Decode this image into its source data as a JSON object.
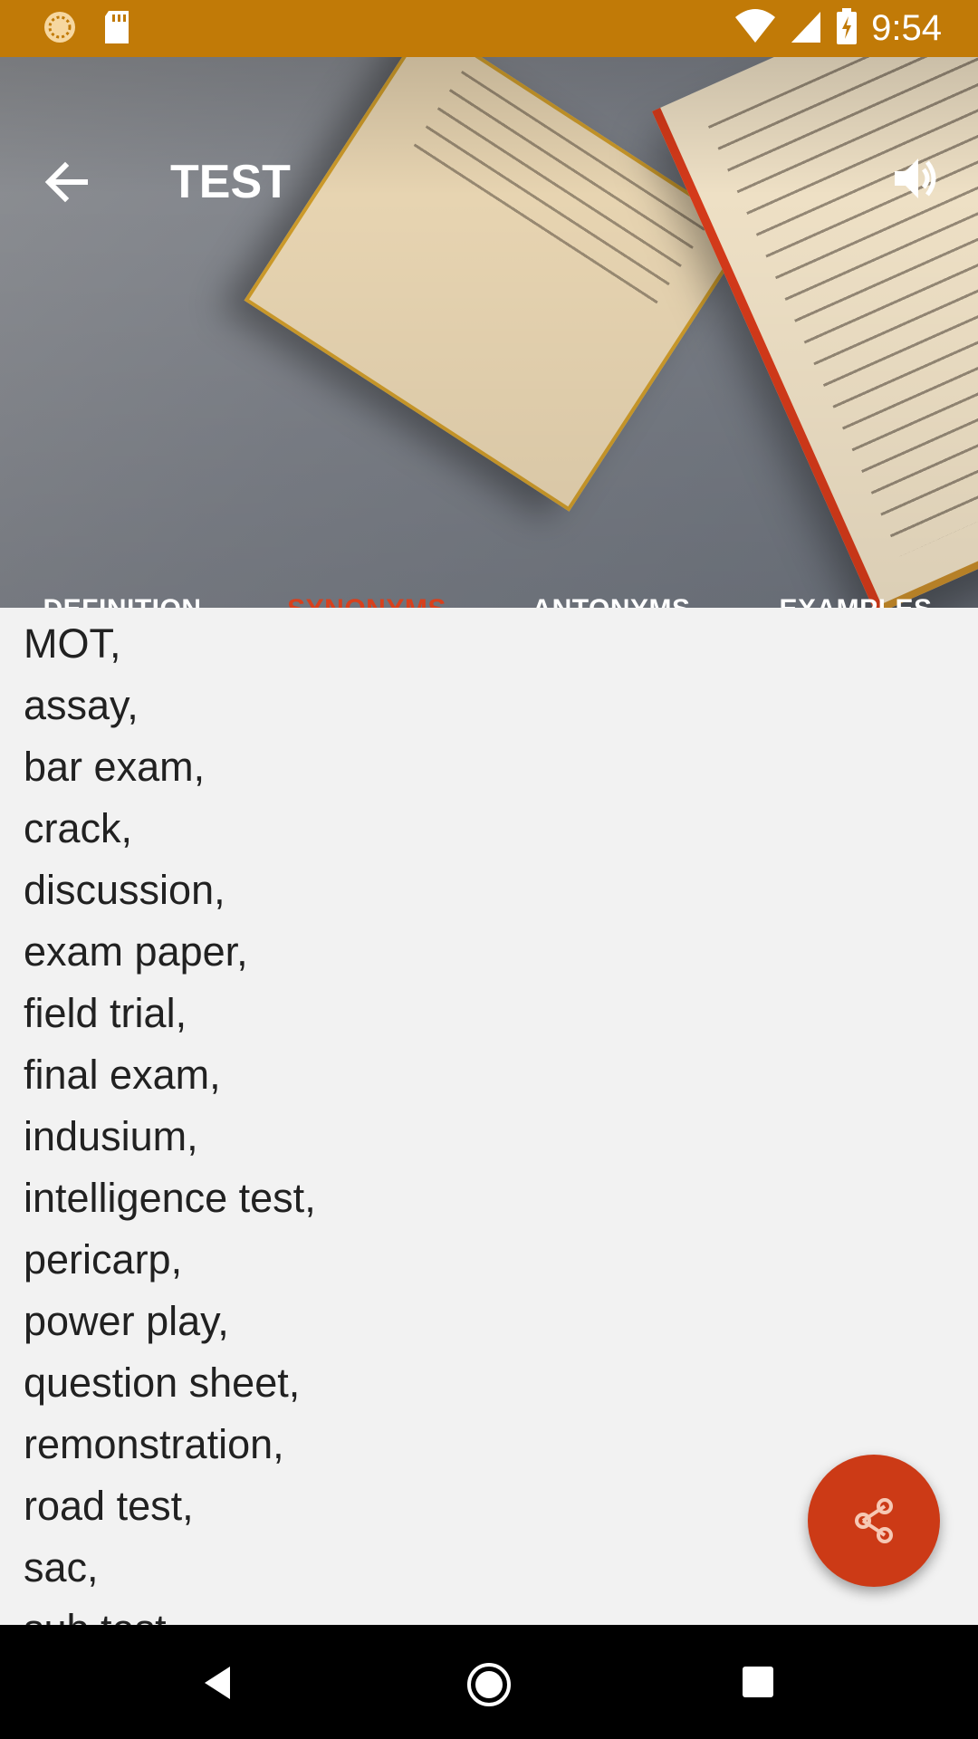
{
  "status_bar": {
    "time": "9:54",
    "left_icons": [
      "sync-icon",
      "sd-card-icon"
    ],
    "right_icons": [
      "wifi-icon",
      "signal-icon",
      "battery-charging-icon"
    ]
  },
  "app_bar": {
    "title": "TEST",
    "back_icon": "arrow-back-icon",
    "volume_icon": "volume-up-icon"
  },
  "tabs": [
    {
      "label": "DEFINITION",
      "active": false
    },
    {
      "label": "SYNONYMS",
      "active": true
    },
    {
      "label": "ANTONYMS",
      "active": false
    },
    {
      "label": "EXAMPLES",
      "active": false
    }
  ],
  "synonyms": [
    "MOT,",
    "assay,",
    "bar exam,",
    "crack,",
    "discussion,",
    "exam paper,",
    "field trial,",
    "final exam,",
    "indusium,",
    "intelligence test,",
    "pericarp,",
    "power play,",
    "question sheet,",
    "remonstration,",
    "road test,",
    "sac,",
    "sub test,"
  ],
  "fab": {
    "icon": "share-icon"
  },
  "colors": {
    "status_bar": "#c17a07",
    "accent": "#d8401c",
    "fab": "#cc3a16",
    "background": "#f2f2f2"
  },
  "nav_bar": {
    "icons": [
      "back-triangle-icon",
      "home-circle-icon",
      "recents-square-icon"
    ]
  }
}
